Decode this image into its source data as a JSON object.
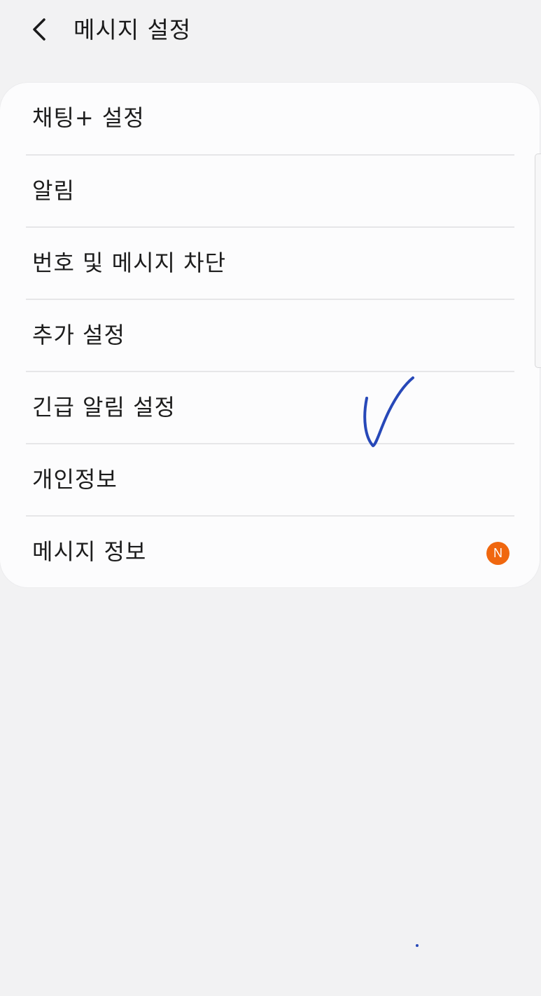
{
  "header": {
    "back_icon": "chevron-left-icon",
    "title": "메시지 설정"
  },
  "menu": {
    "items": [
      {
        "label": "채팅+ 설정"
      },
      {
        "label": "알림"
      },
      {
        "label": "번호 및 메시지 차단"
      },
      {
        "label": "추가 설정"
      },
      {
        "label": "긴급 알림 설정"
      },
      {
        "label": "개인정보"
      },
      {
        "label": "메시지 정보",
        "badge": "N"
      }
    ]
  },
  "colors": {
    "background": "#f2f2f3",
    "card": "#fcfcfd",
    "badge": "#f0670f",
    "annotation_ink": "#2748b8"
  }
}
